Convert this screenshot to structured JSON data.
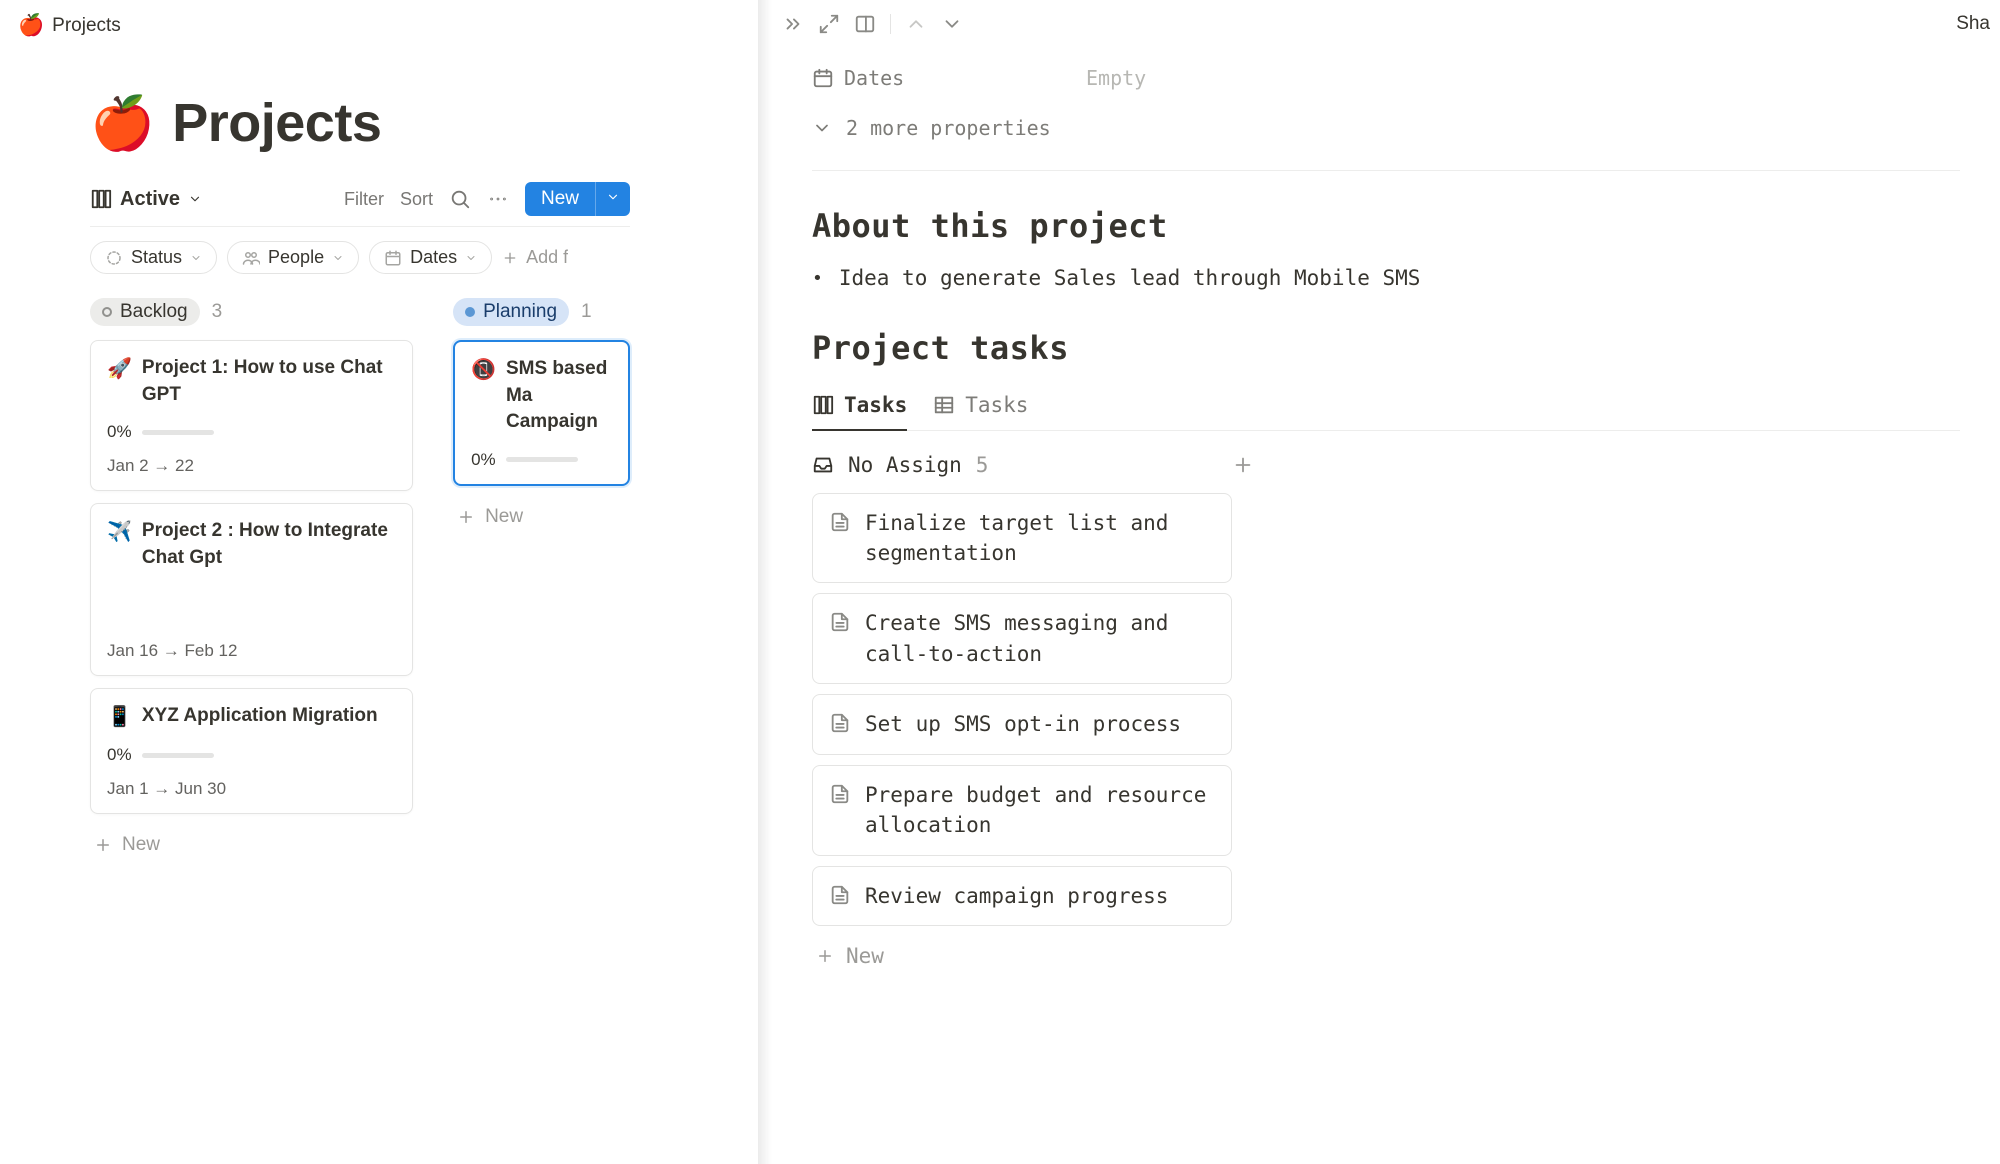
{
  "breadcrumb": {
    "emoji": "🍎",
    "title": "Projects"
  },
  "page": {
    "emoji": "🍎",
    "title": "Projects"
  },
  "viewbar": {
    "active_view": "Active",
    "filter": "Filter",
    "sort": "Sort",
    "new": "New"
  },
  "filters": {
    "status": "Status",
    "people": "People",
    "dates": "Dates",
    "add": "Add f"
  },
  "columns": [
    {
      "id": "backlog",
      "name": "Backlog",
      "count": "3",
      "cards": [
        {
          "emoji": "🚀",
          "title": "Project 1: How to use Chat GPT",
          "progress": "0%",
          "dates": "Jan 2 → 22"
        },
        {
          "emoji": "✈️",
          "title": "Project 2 : How to Integrate Chat Gpt",
          "dates": "Jan 16 → Feb 12"
        },
        {
          "emoji": "📱",
          "title": "XYZ Application Migration",
          "progress": "0%",
          "dates": "Jan 1 → Jun 30"
        }
      ]
    },
    {
      "id": "planning",
      "name": "Planning",
      "count": "1",
      "cards": [
        {
          "emoji": "📵",
          "title": "SMS based Ma Campaign",
          "progress": "0%",
          "selected": true
        }
      ]
    }
  ],
  "new_card_label": "New",
  "panel": {
    "share": "Sha",
    "dates_prop": {
      "label": "Dates",
      "value": "Empty"
    },
    "more_props": "2 more properties",
    "about_head": "About this project",
    "about_bullet": "Idea to generate Sales lead through Mobile SMS",
    "tasks_head": "Project tasks",
    "tabs": {
      "board": "Tasks",
      "table": "Tasks"
    },
    "group": {
      "name": "No Assign",
      "count": "5"
    },
    "tasks": [
      "Finalize target list and segmentation",
      "Create SMS messaging and call-to-action",
      "Set up SMS opt-in process",
      "Prepare budget and resource allocation",
      "Review campaign progress"
    ],
    "new_task": "New"
  }
}
